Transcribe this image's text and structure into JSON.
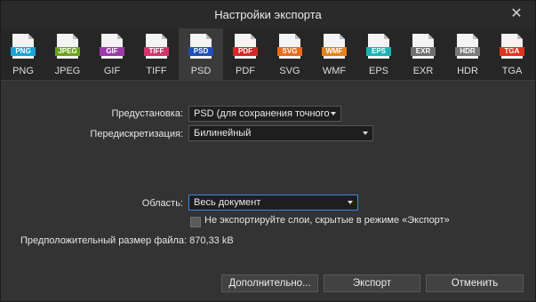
{
  "window": {
    "title": "Настройки экспорта",
    "close_glyph": "✕"
  },
  "formats": [
    {
      "badge": "PNG",
      "label": "PNG",
      "color": "#1aa3d9",
      "selected": false
    },
    {
      "badge": "JPEG",
      "label": "JPEG",
      "color": "#6aa31a",
      "selected": false
    },
    {
      "badge": "GIF",
      "label": "GIF",
      "color": "#9b3aa8",
      "selected": false
    },
    {
      "badge": "TIFF",
      "label": "TIFF",
      "color": "#d6336c",
      "selected": false
    },
    {
      "badge": "PSD",
      "label": "PSD",
      "color": "#1f4fb8",
      "selected": true
    },
    {
      "badge": "PDF",
      "label": "PDF",
      "color": "#d62828",
      "selected": false
    },
    {
      "badge": "SVG",
      "label": "SVG",
      "color": "#e86a1a",
      "selected": false
    },
    {
      "badge": "WMF",
      "label": "WMF",
      "color": "#e8801a",
      "selected": false
    },
    {
      "badge": "EPS",
      "label": "EPS",
      "color": "#1bb3b3",
      "selected": false
    },
    {
      "badge": "EXR",
      "label": "EXR",
      "color": "#6e6e6e",
      "selected": false
    },
    {
      "badge": "HDR",
      "label": "HDR",
      "color": "#7a7a7a",
      "selected": false
    },
    {
      "badge": "TGA",
      "label": "TGA",
      "color": "#e2331f",
      "selected": false
    }
  ],
  "settings": {
    "preset_label": "Предустановка:",
    "preset_value": "PSD (для сохранения точного",
    "resample_label": "Передискретизация:",
    "resample_value": "Билинейный",
    "area_label": "Область:",
    "area_value": "Весь документ",
    "hidden_layers_label": "Не экспортируйте слои, скрытые в режиме «Экспорт»",
    "hidden_layers_checked": false
  },
  "estimate": {
    "text": "Предположительный размер файла: 870,33 kB"
  },
  "buttons": {
    "more": "Дополнительно...",
    "export": "Экспорт",
    "cancel": "Отменить"
  },
  "colors": {
    "accent": "#3a86e8"
  }
}
